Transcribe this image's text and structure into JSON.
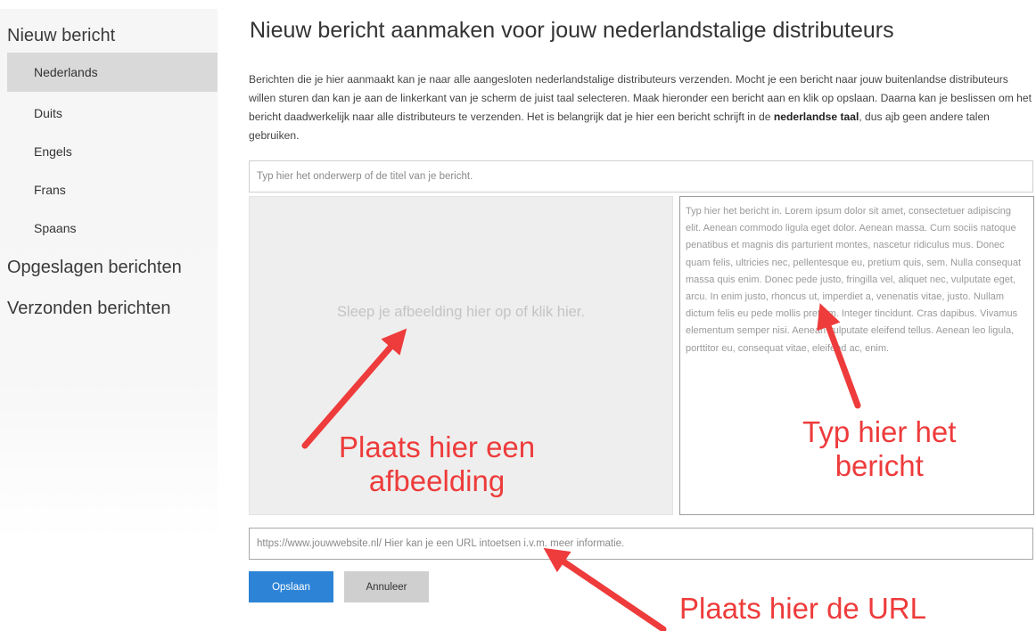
{
  "sidebar": {
    "new_message": "Nieuw bericht",
    "languages": [
      {
        "label": "Nederlands",
        "active": true
      },
      {
        "label": "Duits",
        "active": false
      },
      {
        "label": "Engels",
        "active": false
      },
      {
        "label": "Frans",
        "active": false
      },
      {
        "label": "Spaans",
        "active": false
      }
    ],
    "saved": "Opgeslagen berichten",
    "sent": "Verzonden berichten"
  },
  "main": {
    "title": "Nieuw bericht aanmaken voor jouw nederlandstalige distributeurs",
    "intro_before": "Berichten die je hier aanmaakt kan je naar alle aangesloten nederlandstalige distributeurs verzenden. Mocht je een bericht naar jouw buitenlandse distributeurs willen sturen dan kan je aan de linkerkant van je scherm de juist taal selecteren. Maak hieronder een bericht aan en klik op opslaan. Daarna kan je beslissen om het bericht daadwerkelijk naar alle distributeurs te verzenden. Het is belangrijk dat je hier een bericht schrijft in de ",
    "intro_bold": "nederlandse taal",
    "intro_after": ", dus ajb geen andere talen gebruiken.",
    "subject_placeholder": "Typ hier het onderwerp of de titel van je bericht.",
    "dropzone_text": "Sleep je afbeelding hier op of klik hier.",
    "message_placeholder": "Typ hier het bericht in. Lorem ipsum dolor sit amet, consectetuer adipiscing elit. Aenean commodo ligula eget dolor. Aenean massa. Cum sociis natoque penatibus et magnis dis parturient montes, nascetur ridiculus mus. Donec quam felis, ultricies nec, pellentesque eu, pretium quis, sem. Nulla consequat massa quis enim. Donec pede justo, fringilla vel, aliquet nec, vulputate eget, arcu. In enim justo, rhoncus ut, imperdiet a, venenatis vitae, justo. Nullam dictum felis eu pede mollis pretium. Integer tincidunt. Cras dapibus. Vivamus elementum semper nisi. Aenean vulputate eleifend tellus. Aenean leo ligula, porttitor eu, consequat vitae, eleifend ac, enim.",
    "url_placeholder": "https://www.jouwwebsite.nl/ Hier kan je een URL intoetsen i.v.m. meer informatie.",
    "save_label": "Opslaan",
    "cancel_label": "Annuleer"
  },
  "annotations": {
    "image": [
      "Plaats hier een",
      "afbeelding"
    ],
    "message": [
      "Typ hier het",
      "bericht"
    ],
    "url": "Plaats hier de URL",
    "color": "#ee3b3b"
  }
}
